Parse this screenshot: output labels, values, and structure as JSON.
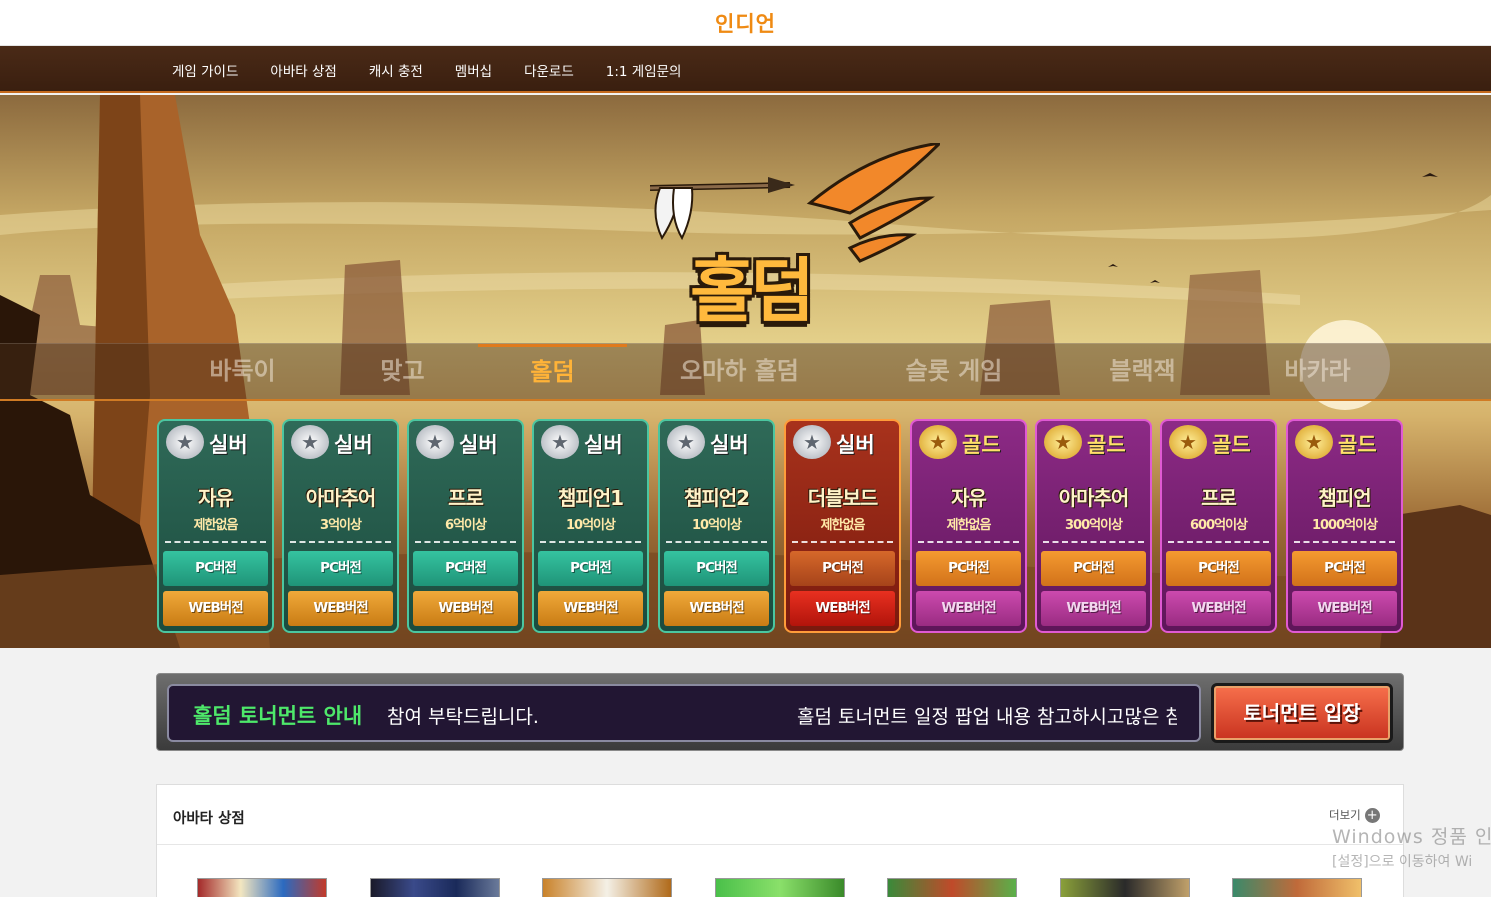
{
  "site": {
    "logo": "인디언"
  },
  "nav": {
    "items": [
      "게임 가이드",
      "아바타 상점",
      "캐시 충전",
      "멤버십",
      "다운로드",
      "1:1 게임문의"
    ]
  },
  "hero": {
    "game_logo": "홀덤",
    "tabs": [
      {
        "label": "바둑이",
        "active": false
      },
      {
        "label": "맞고",
        "active": false
      },
      {
        "label": "홀덤",
        "active": true
      },
      {
        "label": "오마하 홀덤",
        "active": false
      },
      {
        "label": "슬롯 게임",
        "active": false
      },
      {
        "label": "블랙잭",
        "active": false
      },
      {
        "label": "바카라",
        "active": false
      }
    ],
    "pc_label": "PC버전",
    "web_label": "WEB버전",
    "rooms": [
      {
        "tier": "실버",
        "name": "자유",
        "cond": "제한없음",
        "style": "silver"
      },
      {
        "tier": "실버",
        "name": "아마추어",
        "cond": "3억이상",
        "style": "silver"
      },
      {
        "tier": "실버",
        "name": "프로",
        "cond": "6억이상",
        "style": "silver"
      },
      {
        "tier": "실버",
        "name": "챔피언1",
        "cond": "10억이상",
        "style": "silver"
      },
      {
        "tier": "실버",
        "name": "챔피언2",
        "cond": "10억이상",
        "style": "silver"
      },
      {
        "tier": "실버",
        "name": "더블보드",
        "cond": "제한없음",
        "style": "red"
      },
      {
        "tier": "골드",
        "name": "자유",
        "cond": "제한없음",
        "style": "gold"
      },
      {
        "tier": "골드",
        "name": "아마추어",
        "cond": "300억이상",
        "style": "gold"
      },
      {
        "tier": "골드",
        "name": "프로",
        "cond": "600억이상",
        "style": "gold"
      },
      {
        "tier": "골드",
        "name": "챔피언",
        "cond": "1000억이상",
        "style": "gold"
      }
    ]
  },
  "tournament": {
    "title": "홀덤 토너먼트 안내",
    "ticker_a": "참여 부탁드립니다.",
    "ticker_b": "홀덤 토너먼트 일정 팝업 내용 참고하시고많은 참",
    "enter_button": "토너먼트 입장"
  },
  "shop": {
    "title": "아바타 상점",
    "more": "더보기",
    "thumb_count": 7
  },
  "watermark": {
    "line1": "Windows 정품 인",
    "line2": "[설정]으로 이동하여 Wi"
  },
  "colors": {
    "brand_orange": "#ef8a13",
    "nav_brown": "#4a2a17",
    "active_tab": "#ffb338",
    "tourney_green": "#4ee86a"
  },
  "icons": {
    "more": "plus-circle-icon",
    "silver_medal": "silver-medal-icon",
    "gold_medal": "gold-medal-icon"
  }
}
